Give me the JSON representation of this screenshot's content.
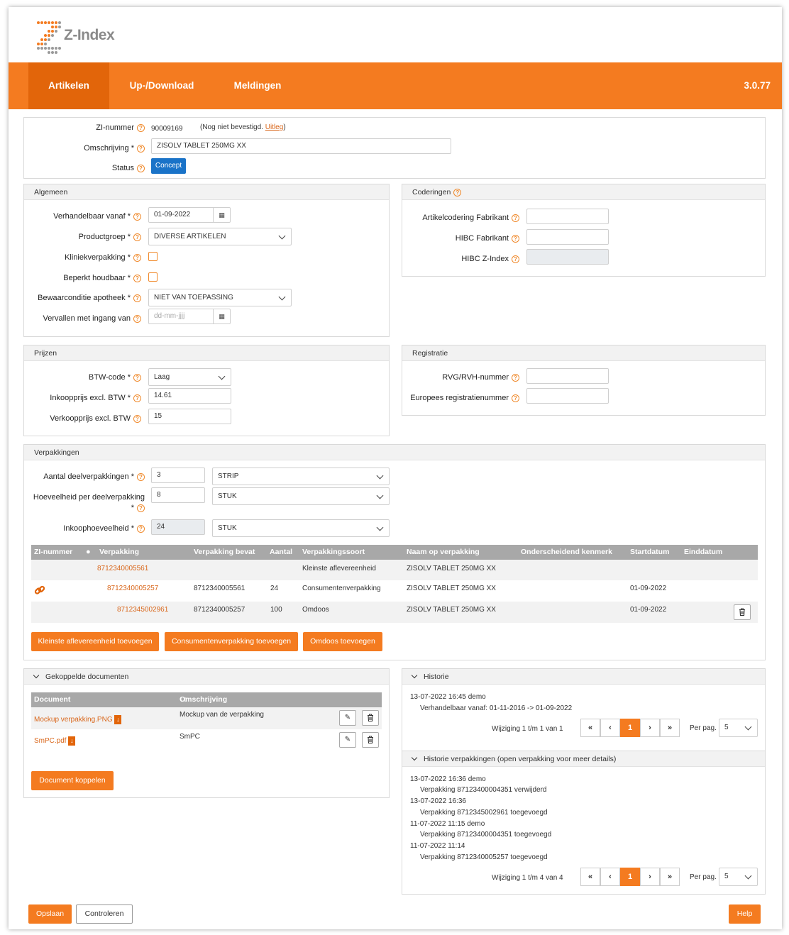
{
  "header": {
    "brand": "Z-Index",
    "version": "3.0.77"
  },
  "nav": {
    "tabs": [
      "Artikelen",
      "Up-/Download",
      "Meldingen"
    ]
  },
  "top": {
    "zi_label": "ZI-nummer",
    "zi_value": "90009169",
    "zi_note_prefix": "(Nog niet bevestigd.",
    "zi_note_link": "Uitleg",
    "zi_note_suffix": ")",
    "omschrijving_label": "Omschrijving *",
    "omschrijving_value": "ZISOLV TABLET 250MG XX",
    "status_label": "Status",
    "status_value": "Concept"
  },
  "algemeen": {
    "title": "Algemeen",
    "verhandelbaar_label": "Verhandelbaar vanaf *",
    "verhandelbaar_value": "01-09-2022",
    "productgroep_label": "Productgroep *",
    "productgroep_value": "DIVERSE ARTIKELEN",
    "kliniek_label": "Kliniekverpakking *",
    "beperkt_label": "Beperkt houdbaar *",
    "bewaar_label": "Bewaarconditie apotheek *",
    "bewaar_value": "NIET VAN TOEPASSING",
    "vervallen_label": "Vervallen met ingang van",
    "vervallen_placeholder": "dd-mm-jjjj"
  },
  "coderingen": {
    "title": "Coderingen",
    "fabrikant_label": "Artikelcodering Fabrikant",
    "hibc_fab_label": "HIBC Fabrikant",
    "hibc_z_label": "HIBC Z-Index"
  },
  "prijzen": {
    "title": "Prijzen",
    "btw_label": "BTW-code *",
    "btw_value": "Laag",
    "inkoop_label": "Inkoopprijs excl. BTW *",
    "inkoop_value": "14.61",
    "verkoop_label": "Verkoopprijs excl. BTW",
    "verkoop_value": "15"
  },
  "registratie": {
    "title": "Registratie",
    "rvg_label": "RVG/RVH-nummer",
    "euro_label": "Europees registratienummer"
  },
  "verpakkingen": {
    "title": "Verpakkingen",
    "aantal_label": "Aantal deelverpakkingen *",
    "aantal_value": "3",
    "aantal_unit": "STRIP",
    "hoeveel_label1": "Hoeveelheid per deelverpakking",
    "hoeveel_label2": "*",
    "hoeveel_value": "8",
    "hoeveel_unit": "STUK",
    "inkoophoev_label": "Inkoophoeveelheid *",
    "inkoophoev_value": "24",
    "inkoophoev_unit": "STUK",
    "headers": [
      "ZI-nummer",
      "Verpakking",
      "Verpakking bevat",
      "Aantal",
      "Verpakkingssoort",
      "Naam op verpakking",
      "Onderscheidend kenmerk",
      "Startdatum",
      "Einddatum"
    ],
    "rows": [
      {
        "verpakking": "8712340005561",
        "bevat": "",
        "aantal": "",
        "soort": "Kleinste aflevereenheid",
        "naam": "ZISOLV TABLET 250MG XX",
        "start": ""
      },
      {
        "verpakking": "8712340005257",
        "bevat": "8712340005561",
        "aantal": "24",
        "soort": "Consumentenverpakking",
        "naam": "ZISOLV TABLET 250MG XX",
        "start": "01-09-2022"
      },
      {
        "verpakking": "8712345002961",
        "bevat": "8712340005257",
        "aantal": "100",
        "soort": "Omdoos",
        "naam": "ZISOLV TABLET 250MG XX",
        "start": "01-09-2022"
      }
    ],
    "buttons": [
      "Kleinste aflevereenheid toevoegen",
      "Consumentenverpakking toevoegen",
      "Omdoos toevoegen"
    ]
  },
  "documenten": {
    "title": "Gekoppelde documenten",
    "headers": [
      "Document",
      "Omschrijving"
    ],
    "rows": [
      {
        "document": "Mockup verpakking.PNG",
        "omschrijving": "Mockup van de verpakking"
      },
      {
        "document": "SmPC.pdf",
        "omschrijving": "SmPC"
      }
    ],
    "button": "Document koppelen"
  },
  "historie": {
    "title": "Historie",
    "entries": [
      {
        "meta": "13-07-2022 16:45   demo",
        "detail": "Verhandelbaar vanaf: 01-11-2016 -> 01-09-2022"
      }
    ],
    "summary": "Wijziging 1 t/m 1 van 1",
    "page": "1",
    "perpag_label": "Per pag.",
    "perpag_value": "5"
  },
  "historie_verp": {
    "title": "Historie verpakkingen (open verpakking voor meer details)",
    "entries": [
      {
        "meta": "13-07-2022 16:36   demo",
        "detail": "Verpakking 87123400004351 verwijderd"
      },
      {
        "meta": "13-07-2022 16:36",
        "detail": "Verpakking 8712345002961 toegevoegd"
      },
      {
        "meta": "11-07-2022 11:15   demo",
        "detail": "Verpakking 87123400004351 toegevoegd"
      },
      {
        "meta": "11-07-2022 11:14",
        "detail": "Verpakking 8712340005257 toegevoegd"
      }
    ],
    "summary": "Wijziging 1 t/m 4 van 4",
    "page": "1",
    "perpag_label": "Per pag.",
    "perpag_value": "5"
  },
  "footer": {
    "save": "Opslaan",
    "check": "Controleren",
    "help": "Help"
  },
  "colors": {
    "accent": "#f47b20",
    "accent_dark": "#e2650a",
    "header_gray": "#a8a8a8"
  }
}
